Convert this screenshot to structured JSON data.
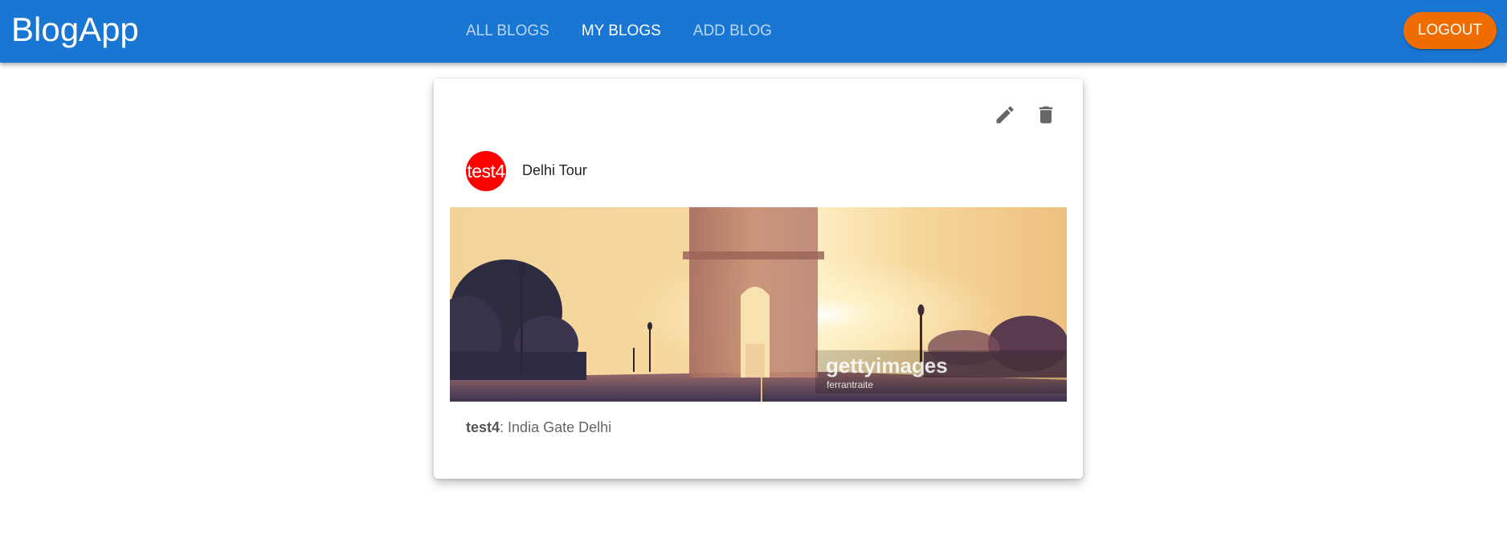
{
  "app": {
    "title": "BlogApp"
  },
  "nav": {
    "tabs": [
      {
        "label": "ALL BLOGS",
        "active": false
      },
      {
        "label": "MY BLOGS",
        "active": true
      },
      {
        "label": "ADD BLOG",
        "active": false
      }
    ],
    "logout_label": "LOGOUT"
  },
  "blog": {
    "avatar_text": "test4",
    "title": "Delhi Tour",
    "author": "test4",
    "separator": ": ",
    "description": "India Gate Delhi",
    "image": {
      "watermark_brand": "gettyimages",
      "watermark_credit": "ferrantraite"
    },
    "actions": {
      "edit_icon": "edit-icon",
      "delete_icon": "delete-icon"
    }
  },
  "colors": {
    "appbar": "#1976d2",
    "logout": "#ef6c00",
    "avatar": "#ff0000"
  }
}
